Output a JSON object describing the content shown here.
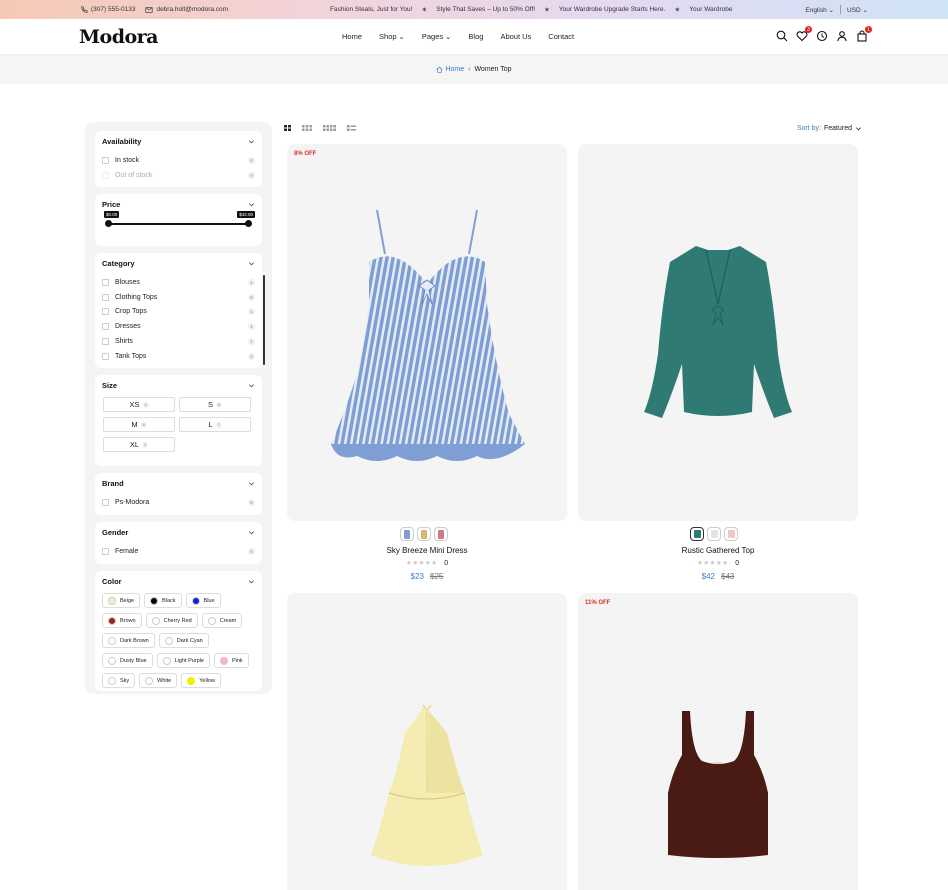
{
  "topbar": {
    "phone": "(307) 555-0133",
    "email": "debra.holt@modora.com",
    "promos": [
      "Fashion Steals, Just for You!",
      "Style That Saves – Up to 50% Off!",
      "Your Wardrobe Upgrade Starts Here.",
      "Your Wardrobe"
    ],
    "language": "English",
    "currency": "USD"
  },
  "header": {
    "logo": "Modora",
    "nav": [
      "Home",
      "Shop",
      "Pages",
      "Blog",
      "About Us",
      "Contact"
    ],
    "wishlist_count": "3",
    "cart_count": "1"
  },
  "breadcrumb": {
    "home": "Home",
    "current": "Women Top"
  },
  "filters": {
    "availability": {
      "title": "Availability",
      "options": [
        {
          "label": "In stock",
          "count": "8"
        },
        {
          "label": "Out of stock",
          "count": "0"
        }
      ]
    },
    "price": {
      "title": "Price",
      "min": "$0.00",
      "max": "$42.00"
    },
    "category": {
      "title": "Category",
      "options": [
        {
          "label": "Blouses",
          "count": "1"
        },
        {
          "label": "Clothing Tops",
          "count": "6"
        },
        {
          "label": "Crop Tops",
          "count": "1"
        },
        {
          "label": "Dresses",
          "count": "1"
        },
        {
          "label": "Shirts",
          "count": "1"
        },
        {
          "label": "Tank Tops",
          "count": "2"
        }
      ]
    },
    "size": {
      "title": "Size",
      "options": [
        {
          "label": "XS",
          "count": "4"
        },
        {
          "label": "S",
          "count": "6"
        },
        {
          "label": "M",
          "count": "8"
        },
        {
          "label": "L",
          "count": "7"
        },
        {
          "label": "XL",
          "count": "3"
        }
      ]
    },
    "brand": {
      "title": "Brand",
      "options": [
        {
          "label": "Ps-Modora",
          "count": "8"
        }
      ]
    },
    "gender": {
      "title": "Gender",
      "options": [
        {
          "label": "Female",
          "count": "8"
        }
      ]
    },
    "color": {
      "title": "Color",
      "options": [
        {
          "label": "Beige",
          "hex": "#f3efc9"
        },
        {
          "label": "Black",
          "hex": "#000000"
        },
        {
          "label": "Blue",
          "hex": "#1a1ae0"
        },
        {
          "label": "Brown",
          "hex": "#9b2323"
        },
        {
          "label": "Cherry Red",
          "hex": "#ffffff"
        },
        {
          "label": "Cream",
          "hex": "#ffffff"
        },
        {
          "label": "Dark Brown",
          "hex": "#ffffff"
        },
        {
          "label": "Dark Cyan",
          "hex": "#ffffff"
        },
        {
          "label": "Dusty Blue",
          "hex": "#ffffff"
        },
        {
          "label": "Light Purple",
          "hex": "#ffffff"
        },
        {
          "label": "Pink",
          "hex": "#f7b5c9"
        },
        {
          "label": "Sky",
          "hex": "#ffffff"
        },
        {
          "label": "White",
          "hex": "#ffffff"
        },
        {
          "label": "Yellow",
          "hex": "#f0f000"
        }
      ]
    }
  },
  "toolbar": {
    "sort_label": "Sort by:",
    "sort_value": "Featured"
  },
  "products": [
    {
      "name": "Sky Breeze Mini Dress",
      "badge": "8% OFF",
      "rating": "0",
      "price": "$23",
      "old_price": "$25"
    },
    {
      "name": "Rustic Gathered Top",
      "badge": "",
      "rating": "0",
      "price": "$42",
      "old_price": "$43"
    },
    {
      "name": "",
      "badge": "",
      "rating": "",
      "price": "",
      "old_price": ""
    },
    {
      "name": "",
      "badge": "11% OFF",
      "rating": "",
      "price": "",
      "old_price": ""
    }
  ]
}
